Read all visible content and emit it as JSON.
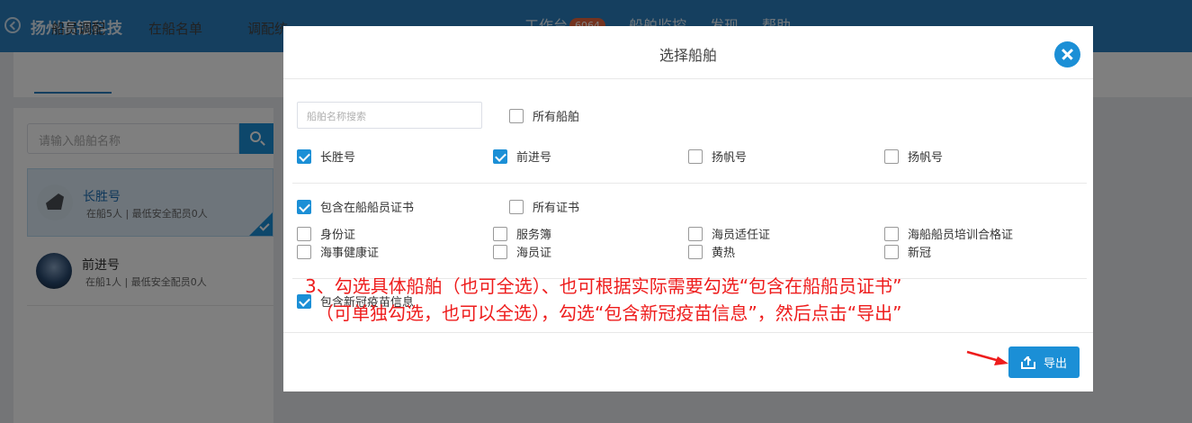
{
  "app": {
    "company": "扬州高银科技",
    "nav": [
      {
        "label": "工作台",
        "badge": "6064"
      },
      {
        "label": "船舶监控"
      },
      {
        "label": "发现"
      },
      {
        "label": "帮助"
      }
    ]
  },
  "tabs": [
    "船员调配",
    "在船名单",
    "调配统"
  ],
  "left": {
    "search_placeholder": "请输入船舶名称",
    "ships": [
      {
        "name": "长胜号",
        "info": "在船5人 | 最低安全配员0人",
        "selected": true
      },
      {
        "name": "前进号",
        "info": "在船1人 | 最低安全配员0人",
        "selected": false
      }
    ]
  },
  "modal": {
    "title": "选择船舶",
    "search_placeholder": "船舶名称搜索",
    "all_ships_label": "所有船舶",
    "ships": [
      {
        "label": "长胜号",
        "checked": true
      },
      {
        "label": "前进号",
        "checked": true
      },
      {
        "label": "扬帆号",
        "checked": false
      },
      {
        "label": "扬帆号",
        "checked": false
      }
    ],
    "include_certs_label": "包含在船船员证书",
    "all_certs_label": "所有证书",
    "certs": [
      {
        "label": "身份证",
        "checked": false
      },
      {
        "label": "服务簿",
        "checked": false
      },
      {
        "label": "海员适任证",
        "checked": false
      },
      {
        "label": "海船船员培训合格证",
        "checked": false
      },
      {
        "label": "海事健康证",
        "checked": false
      },
      {
        "label": "海员证",
        "checked": false
      },
      {
        "label": "黄热",
        "checked": false
      },
      {
        "label": "新冠",
        "checked": false
      }
    ],
    "include_vaccine_label": "包含新冠疫苗信息",
    "export_label": "导出"
  },
  "annotation": {
    "line1": "3、勾选具体船舶（也可全选）、也可根据实际需要勾选“包含在船船员证书”",
    "line2": "（可单独勾选，也可以全选），勾选“包含新冠疫苗信息”，然后点击“导出”"
  },
  "colors": {
    "primary": "#1b8fd6",
    "header": "#2b7fbf",
    "annotation": "#ee1c1c"
  }
}
